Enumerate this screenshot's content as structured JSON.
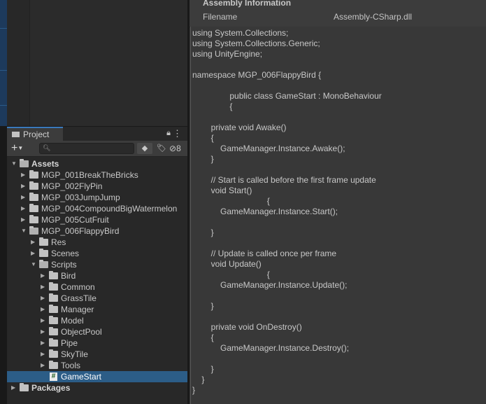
{
  "project": {
    "tab_label": "Project",
    "hidden_count": "8",
    "tree": [
      {
        "label": "Assets",
        "depth": 0,
        "expanded": true,
        "kind": "folder",
        "bold": true
      },
      {
        "label": "MGP_001BreakTheBricks",
        "depth": 1,
        "expanded": false,
        "kind": "folder"
      },
      {
        "label": "MGP_002FlyPin",
        "depth": 1,
        "expanded": false,
        "kind": "folder"
      },
      {
        "label": "MGP_003JumpJump",
        "depth": 1,
        "expanded": false,
        "kind": "folder"
      },
      {
        "label": "MGP_004CompoundBigWatermelon",
        "depth": 1,
        "expanded": false,
        "kind": "folder"
      },
      {
        "label": "MGP_005CutFruit",
        "depth": 1,
        "expanded": false,
        "kind": "folder"
      },
      {
        "label": "MGP_006FlappyBird",
        "depth": 1,
        "expanded": true,
        "kind": "folder"
      },
      {
        "label": "Res",
        "depth": 2,
        "expanded": false,
        "kind": "folder"
      },
      {
        "label": "Scenes",
        "depth": 2,
        "expanded": false,
        "kind": "folder"
      },
      {
        "label": "Scripts",
        "depth": 2,
        "expanded": true,
        "kind": "folder"
      },
      {
        "label": "Bird",
        "depth": 3,
        "expanded": false,
        "kind": "folder"
      },
      {
        "label": "Common",
        "depth": 3,
        "expanded": false,
        "kind": "folder"
      },
      {
        "label": "GrassTile",
        "depth": 3,
        "expanded": false,
        "kind": "folder"
      },
      {
        "label": "Manager",
        "depth": 3,
        "expanded": false,
        "kind": "folder"
      },
      {
        "label": "Model",
        "depth": 3,
        "expanded": false,
        "kind": "folder"
      },
      {
        "label": "ObjectPool",
        "depth": 3,
        "expanded": false,
        "kind": "folder"
      },
      {
        "label": "Pipe",
        "depth": 3,
        "expanded": false,
        "kind": "folder"
      },
      {
        "label": "SkyTile",
        "depth": 3,
        "expanded": false,
        "kind": "folder"
      },
      {
        "label": "Tools",
        "depth": 3,
        "expanded": false,
        "kind": "folder"
      },
      {
        "label": "GameStart",
        "depth": 3,
        "kind": "script",
        "selected": true
      },
      {
        "label": "Packages",
        "depth": 0,
        "expanded": false,
        "kind": "folder",
        "bold": true
      }
    ]
  },
  "inspector": {
    "section_title": "Assembly Information",
    "filename_label": "Filename",
    "filename_value": "Assembly-CSharp.dll",
    "code_lines": [
      "using System.Collections;",
      "using System.Collections.Generic;",
      "using UnityEngine;",
      "",
      "namespace MGP_006FlappyBird {",
      "",
      "                public class GameStart : MonoBehaviour",
      "                {",
      "",
      "        private void Awake()",
      "        {",
      "            GameManager.Instance.Awake();",
      "        }",
      "",
      "        // Start is called before the first frame update",
      "        void Start()",
      "                                {",
      "            GameManager.Instance.Start();",
      "",
      "        }",
      "",
      "        // Update is called once per frame",
      "        void Update()",
      "                                {",
      "            GameManager.Instance.Update();",
      "",
      "        }",
      "",
      "        private void OnDestroy()",
      "        {",
      "            GameManager.Instance.Destroy();",
      "",
      "        }",
      "    }",
      "}"
    ]
  },
  "colors": {
    "selection": "#2c5d87",
    "tab_accent": "#3a79bb",
    "panel_bg": "#282828",
    "inspector_bg": "#383838"
  }
}
